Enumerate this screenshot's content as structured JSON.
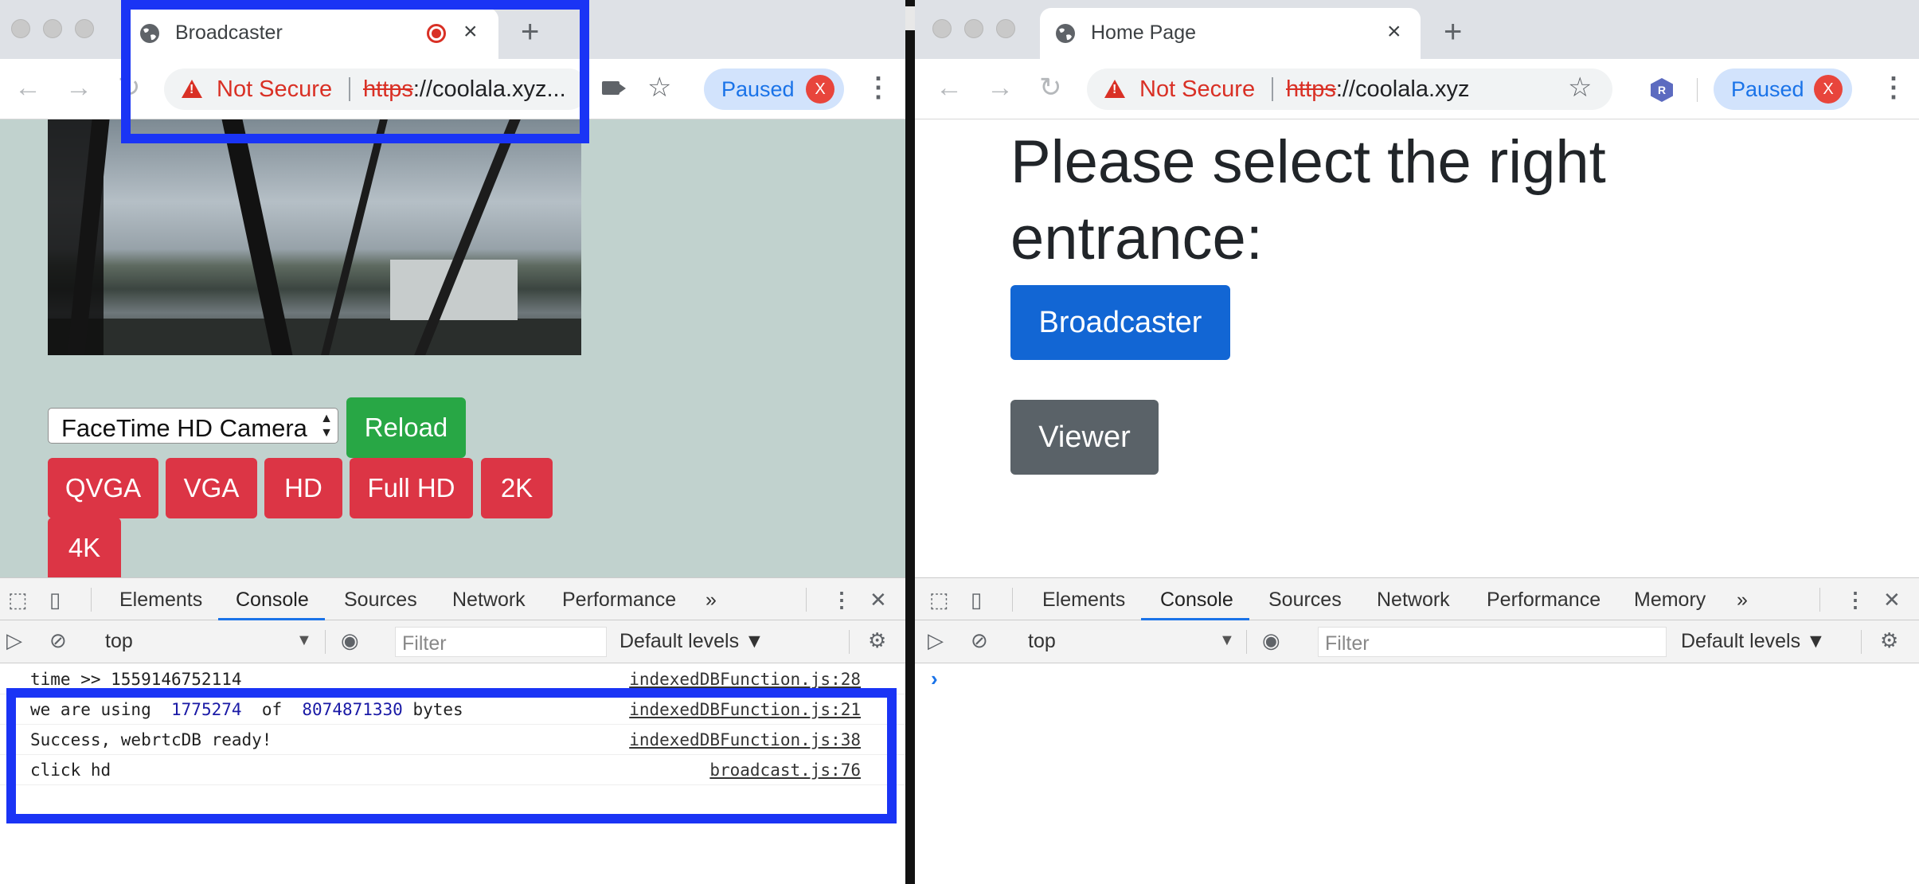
{
  "left_window": {
    "tab_title": "Broadcaster",
    "tab_close": "×",
    "new_tab": "+",
    "not_secure": "Not Secure",
    "url_scheme": "https",
    "url_rest": "://coolala.xyz...",
    "paused_label": "Paused",
    "avatar_letter": "X",
    "camera_select_value": "FaceTime HD Camera",
    "buttons": {
      "reload": "Reload",
      "qvga": "QVGA",
      "vga": "VGA",
      "hd": "HD",
      "fullhd": "Full HD",
      "twok": "2K",
      "fourk": "4K"
    },
    "devtools": {
      "tabs": [
        "Elements",
        "Console",
        "Sources",
        "Network",
        "Performance"
      ],
      "more": "»",
      "context": "top",
      "filter_placeholder": "Filter",
      "levels": "Default levels ▼",
      "logs": [
        {
          "text": "time >> 1559146752114",
          "source": "indexedDBFunction.js:28"
        },
        {
          "pre": "we are using  ",
          "num1": "1775274",
          "mid": "  of  ",
          "num2": "8074871330",
          "post": " bytes",
          "source": "indexedDBFunction.js:21"
        },
        {
          "text": "Success, webrtcDB ready!",
          "source": "indexedDBFunction.js:38"
        },
        {
          "text": "click hd",
          "source": "broadcast.js:76"
        }
      ]
    }
  },
  "right_window": {
    "tab_title": "Home Page",
    "tab_close": "×",
    "new_tab": "+",
    "not_secure": "Not Secure",
    "url_scheme": "https",
    "url_rest": "://coolala.xyz",
    "paused_label": "Paused",
    "avatar_letter": "X",
    "extension_letter": "R",
    "headline": "Please select the right entrance:",
    "buttons": {
      "broadcaster": "Broadcaster",
      "viewer": "Viewer"
    },
    "devtools": {
      "tabs": [
        "Elements",
        "Console",
        "Sources",
        "Network",
        "Performance",
        "Memory"
      ],
      "more": "»",
      "context": "top",
      "filter_placeholder": "Filter",
      "levels": "Default levels ▼",
      "prompt": "›"
    }
  },
  "colors": {
    "highlight": "#1a34f5",
    "page_bg_left": "#c1d2ce",
    "danger": "#dc3545",
    "success": "#28a745",
    "primary": "#1266d4",
    "secondary": "#5a6268"
  }
}
